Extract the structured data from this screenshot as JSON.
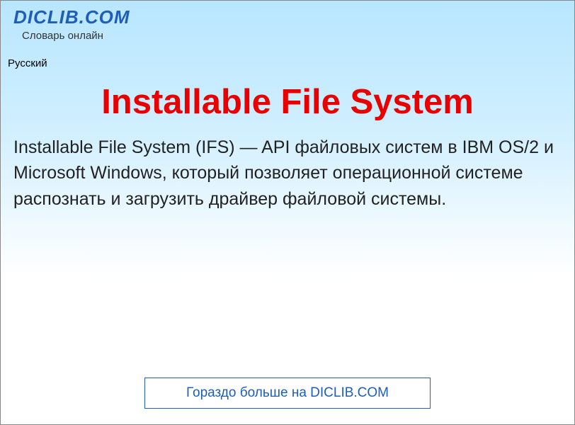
{
  "header": {
    "site_name": "DICLIB.COM",
    "tagline": "Словарь онлайн"
  },
  "language_label": "Русский",
  "article": {
    "title": "Installable File System",
    "body": "Installable File System (IFS) — API файловых систем в IBM OS/2 и Microsoft Windows, который позволяет операционной системе распознать и загрузить драйвер файловой системы."
  },
  "footer": {
    "link_text": "Гораздо больше на DICLIB.COM"
  }
}
